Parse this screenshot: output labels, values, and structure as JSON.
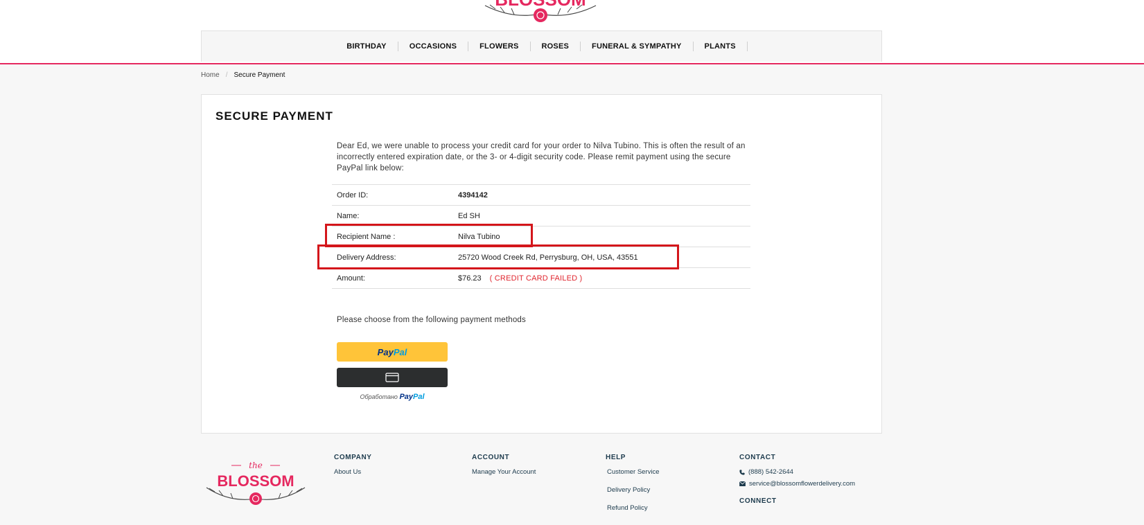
{
  "brand": {
    "top_logo_text": "BLOSSOM",
    "footer_logo_the": "the",
    "footer_logo_name": "BLOSSOM",
    "accent": "#e5285f"
  },
  "nav": {
    "items": [
      "BIRTHDAY",
      "OCCASIONS",
      "FLOWERS",
      "ROSES",
      "FUNERAL & SYMPATHY",
      "PLANTS"
    ]
  },
  "breadcrumb": {
    "home": "Home",
    "separator": "/",
    "current": "Secure Payment"
  },
  "page": {
    "title": "SECURE PAYMENT",
    "message": "Dear Ed, we were unable to process your credit card for your order to Nilva Tubino. This is often the result of an incorrectly entered expiration date, or the 3- or 4-digit security code. Please remit payment using the secure PayPal link below:",
    "details": [
      {
        "label": "Order ID:",
        "value": "4394142"
      },
      {
        "label": "Name:",
        "value": "Ed SH"
      },
      {
        "label": "Recipient Name :",
        "value": "Nilva Tubino"
      },
      {
        "label": "Delivery Address:",
        "value": "25720 Wood Creek Rd, Perrysburg, OH, USA, 43551"
      },
      {
        "label": "Amount:",
        "value": "$76.23",
        "status": "( CREDIT CARD FAILED )"
      }
    ],
    "choose_text": "Please choose from the following payment methods",
    "paypal_pay": "Pay",
    "paypal_pal": "Pal",
    "powered_by": "Обработано"
  },
  "footer": {
    "company": {
      "heading": "COMPANY",
      "links": [
        "About Us"
      ]
    },
    "account": {
      "heading": "ACCOUNT",
      "links": [
        "Manage Your Account"
      ]
    },
    "help": {
      "heading": "HELP",
      "links": [
        "Customer Service",
        "Delivery Policy",
        "Refund Policy"
      ]
    },
    "contact": {
      "heading": "CONTACT",
      "phone": "(888) 542-2644",
      "email": "service@blossomflowerdelivery.com",
      "connect_heading": "CONNECT"
    }
  }
}
